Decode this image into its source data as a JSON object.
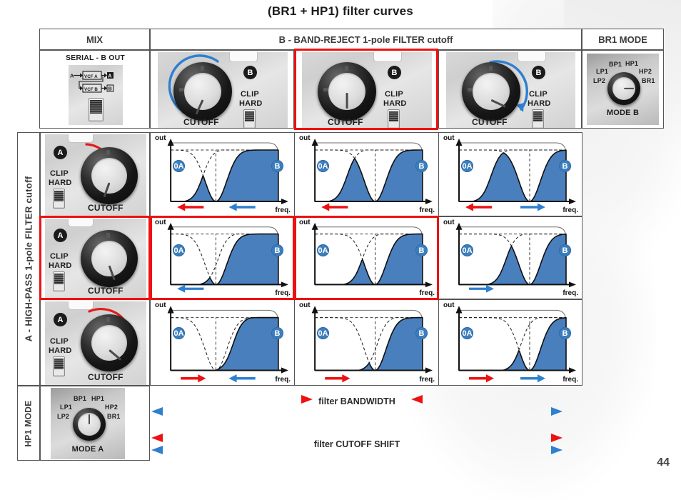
{
  "title": "(BR1 + HP1) filter curves",
  "page_number": "44",
  "columns": {
    "mix": "MIX",
    "band_reject": "B - BAND-REJECT 1-pole FILTER cutoff",
    "br1_mode": "BR1 MODE"
  },
  "rows": {
    "high_pass": "A - HIGH-PASS 1-pole FILTER cutoff",
    "hp1_mode": "HP1 MODE"
  },
  "mix_panel": {
    "caption": "SERIAL - B OUT",
    "in_label": "A",
    "vcf_a": "VCF A",
    "vcf_b": "VCF B",
    "out_a": "A",
    "out_b": "B"
  },
  "knob_labels": {
    "cutoff": "CUTOFF",
    "clip": "CLIP",
    "hard": "HARD",
    "badge_a": "A",
    "badge_b": "B"
  },
  "mode_knob": {
    "positions": [
      "LP2",
      "LP1",
      "BP1",
      "HP1",
      "HP2",
      "BR1"
    ],
    "caption_a": "MODE A",
    "caption_b": "MODE B"
  },
  "graph_labels": {
    "y": "out",
    "x": "freq.",
    "marker_a": "A",
    "marker_b": "B"
  },
  "legend": {
    "bandwidth": "filter BANDWIDTH",
    "cutoff_shift": "filter CUTOFF SHIFT"
  },
  "colors": {
    "fill_blue": "#4a7fbd",
    "marker_blue": "#3d7ebd",
    "arrow_red": "#ee1111",
    "arrow_blue": "#2f7fd0",
    "highlight_red": "#ee1111",
    "grid_gray": "#555555"
  },
  "chart_data": {
    "type": "area",
    "title": "(BR1 + HP1) filter curves",
    "xlabel": "freq.",
    "ylabel": "out",
    "grid": false,
    "legend_position": "bottom",
    "note": "3x3 matrix of filter response curves. Rows = A high-pass cutoff (low / center / high). Columns = B band-reject cutoff (low / center / high). Solid filled curve = combined (BR1 + HP1) response; dashed curves = the individual HP1 and BR1 responses.",
    "row_arrow_directions": [
      "left",
      "none",
      "right"
    ],
    "col_arrow_directions": [
      "left",
      "none",
      "right"
    ],
    "cells": [
      {
        "row": 1,
        "col": 1,
        "arrows": [
          {
            "color": "#ee1111",
            "dir": "left"
          },
          {
            "color": "#2f7fd0",
            "dir": "left"
          }
        ],
        "highlight": false
      },
      {
        "row": 1,
        "col": 2,
        "arrows": [
          {
            "color": "#ee1111",
            "dir": "left"
          }
        ],
        "highlight": false
      },
      {
        "row": 1,
        "col": 3,
        "arrows": [
          {
            "color": "#ee1111",
            "dir": "left"
          },
          {
            "color": "#2f7fd0",
            "dir": "right"
          }
        ],
        "highlight": false
      },
      {
        "row": 2,
        "col": 1,
        "arrows": [
          {
            "color": "#2f7fd0",
            "dir": "left"
          }
        ],
        "highlight": true
      },
      {
        "row": 2,
        "col": 2,
        "arrows": [],
        "highlight": true
      },
      {
        "row": 2,
        "col": 3,
        "arrows": [
          {
            "color": "#2f7fd0",
            "dir": "right"
          }
        ],
        "highlight": false
      },
      {
        "row": 3,
        "col": 1,
        "arrows": [
          {
            "color": "#ee1111",
            "dir": "right"
          },
          {
            "color": "#2f7fd0",
            "dir": "left"
          }
        ],
        "highlight": false
      },
      {
        "row": 3,
        "col": 2,
        "arrows": [
          {
            "color": "#ee1111",
            "dir": "right"
          }
        ],
        "highlight": false
      },
      {
        "row": 3,
        "col": 3,
        "arrows": [
          {
            "color": "#ee1111",
            "dir": "right"
          },
          {
            "color": "#2f7fd0",
            "dir": "right"
          }
        ],
        "highlight": false
      }
    ]
  }
}
